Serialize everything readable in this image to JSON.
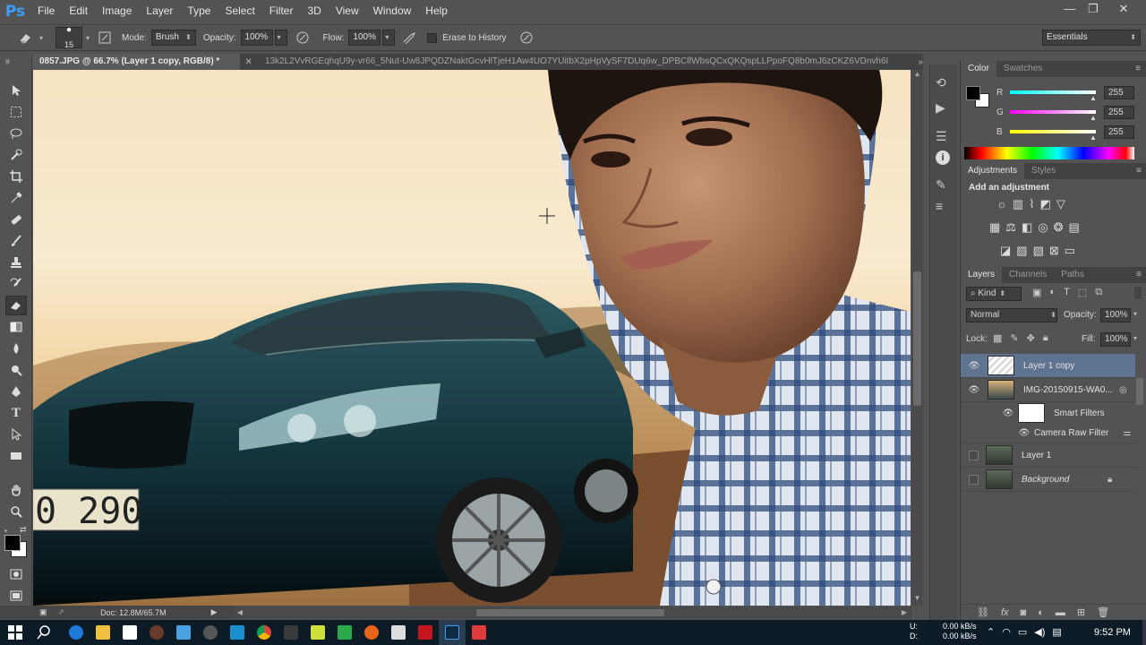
{
  "app": {
    "logo": "Ps"
  },
  "menus": [
    "File",
    "Edit",
    "Image",
    "Layer",
    "Type",
    "Select",
    "Filter",
    "3D",
    "View",
    "Window",
    "Help"
  ],
  "window_controls": {
    "minimize": "—",
    "restore": "❐",
    "close": "✕"
  },
  "options": {
    "brush_size": "15",
    "mode_label": "Mode:",
    "mode_value": "Brush",
    "opacity_label": "Opacity:",
    "opacity_value": "100%",
    "flow_label": "Flow:",
    "flow_value": "100%",
    "erase_to_history": "Erase to History",
    "workspace": "Essentials"
  },
  "tabs": {
    "active": "0857.JPG @ 66.7% (Layer 1 copy, RGB/8) *",
    "inactive": "13k2L2VvRGEqhqU9y-vr66_5Nut-Uw8JPQDZNaktGcvHlTjeH1Aw4UO7YUitbX2pHpVySF7DUq6w_DPBClfWbsQCxQKQspLLPpoFQ8b0mJ6zCKZ6VDnvh6I"
  },
  "canvas": {
    "plate_text": "0 290"
  },
  "status": {
    "doc": "Doc: 12.8M/65.7M"
  },
  "color_panel": {
    "tabs": [
      "Color",
      "Swatches"
    ],
    "r_label": "R",
    "g_label": "G",
    "b_label": "B",
    "r": "255",
    "g": "255",
    "b": "255"
  },
  "adjustments": {
    "tabs": [
      "Adjustments",
      "Styles"
    ],
    "heading": "Add an adjustment"
  },
  "layers_panel": {
    "tabs": [
      "Layers",
      "Channels",
      "Paths"
    ],
    "filter_kind": "Kind",
    "blend_mode": "Normal",
    "opacity_label": "Opacity:",
    "opacity": "100%",
    "lock_label": "Lock:",
    "fill_label": "Fill:",
    "fill": "100%",
    "layers": [
      {
        "name": "Layer 1 copy"
      },
      {
        "name": "IMG-20150915-WA0..."
      },
      {
        "name": "Smart Filters"
      },
      {
        "name": "Camera Raw Filter"
      },
      {
        "name": "Layer 1"
      },
      {
        "name": "Background"
      }
    ]
  },
  "taskbar": {
    "net_up_label": "U:",
    "net_down_label": "D:",
    "net_up": "0.00 kB/s",
    "net_down": "0.00 kB/s",
    "time": "9:52 PM"
  }
}
